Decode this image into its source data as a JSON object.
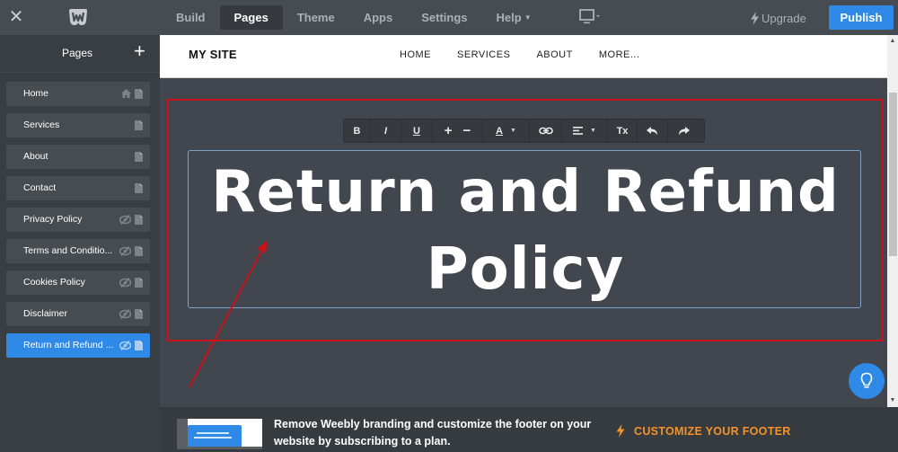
{
  "topbar": {
    "close_icon": "close-icon",
    "logo": "weebly-logo",
    "tabs": [
      {
        "label": "Build",
        "active": false
      },
      {
        "label": "Pages",
        "active": true
      },
      {
        "label": "Theme",
        "active": false
      },
      {
        "label": "Apps",
        "active": false
      },
      {
        "label": "Settings",
        "active": false
      },
      {
        "label": "Help",
        "active": false,
        "has_caret": true
      }
    ],
    "device_icon": "monitor-icon",
    "upgrade_label": "Upgrade",
    "publish_label": "Publish"
  },
  "sidebar": {
    "title": "Pages",
    "add_label": "+",
    "items": [
      {
        "label": "Home",
        "icons": [
          "home-icon",
          "page-icon"
        ],
        "active": false
      },
      {
        "label": "Services",
        "icons": [
          "page-icon"
        ],
        "active": false
      },
      {
        "label": "About",
        "icons": [
          "page-icon"
        ],
        "active": false
      },
      {
        "label": "Contact",
        "icons": [
          "page-icon"
        ],
        "active": false
      },
      {
        "label": "Privacy Policy",
        "icons": [
          "hidden-icon",
          "page-icon"
        ],
        "active": false
      },
      {
        "label": "Terms and Conditio...",
        "icons": [
          "hidden-icon",
          "page-icon"
        ],
        "active": false
      },
      {
        "label": "Cookies Policy",
        "icons": [
          "hidden-icon",
          "page-icon"
        ],
        "active": false
      },
      {
        "label": "Disclaimer",
        "icons": [
          "hidden-icon",
          "page-icon"
        ],
        "active": false
      },
      {
        "label": "Return and Refund ...",
        "icons": [
          "hidden-icon",
          "page-icon"
        ],
        "active": true
      }
    ]
  },
  "site": {
    "brand": "MY SITE",
    "menu": [
      "HOME",
      "SERVICES",
      "ABOUT",
      "MORE..."
    ]
  },
  "editor": {
    "toolbar": [
      {
        "name": "bold-button",
        "label": "B"
      },
      {
        "name": "italic-button",
        "label": "I"
      },
      {
        "name": "underline-button",
        "label": "U"
      },
      {
        "name": "font-size-buttons",
        "label": "+ −"
      },
      {
        "name": "text-color-button",
        "label": "A"
      },
      {
        "name": "link-button",
        "label": "link"
      },
      {
        "name": "align-button",
        "label": "align"
      },
      {
        "name": "clear-format-button",
        "label": "Tx"
      },
      {
        "name": "undo-button",
        "label": "undo"
      },
      {
        "name": "redo-button",
        "label": "redo"
      }
    ],
    "headline_line1": "Return and Refund",
    "headline_line2": "Policy"
  },
  "footer": {
    "message": "Remove Weebly branding and customize the footer on your website by subscribing to a plan.",
    "cta_label": "CUSTOMIZE YOUR FOOTER"
  },
  "colors": {
    "accent": "#2e8ae6",
    "topbar": "#464c51",
    "sidebar": "#393e43",
    "canvas": "#41464f",
    "annotation_red": "#c8141c",
    "cta_orange": "#f5922a"
  }
}
